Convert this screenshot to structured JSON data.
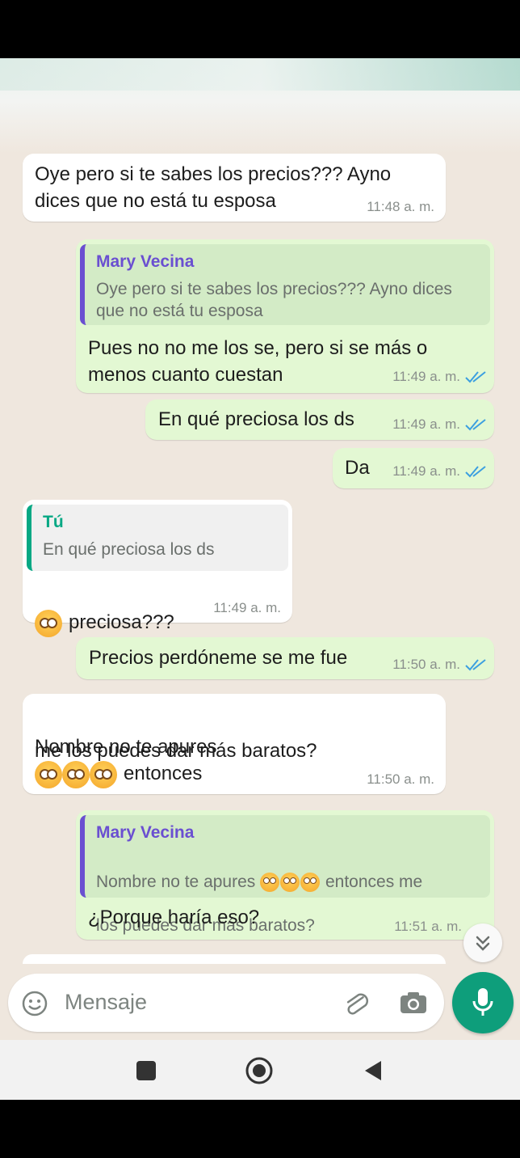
{
  "messages": {
    "m1": {
      "text": "Oye pero si te sabes los precios??? Ayno\ndices que no está tu esposa",
      "time": "11:48 a. m."
    },
    "m2": {
      "quote_name": "Mary Vecina",
      "quote_text": "Oye pero si te sabes los precios??? Ayno dices\nque no está tu esposa",
      "text": "Pues no no me los se, pero si se más o\nmenos cuanto cuestan",
      "time": "11:49 a. m."
    },
    "m3": {
      "text": "En qué preciosa los ds",
      "time": "11:49 a. m."
    },
    "m4": {
      "text": "Da",
      "time": "11:49 a. m."
    },
    "m5": {
      "quote_name": "Tú",
      "quote_text": "En qué preciosa los ds",
      "text": "preciosa???",
      "time": "11:49 a. m."
    },
    "m6": {
      "text": "Precios perdóneme se me fue",
      "time": "11:50 a. m."
    },
    "m7": {
      "text_a": "Nombre no te apures",
      "text_b": "entonces",
      "text_c": "me los puedes dar más baratos?",
      "time": "11:50 a. m."
    },
    "m8": {
      "quote_name": "Mary Vecina",
      "quote_a": "Nombre no te apures",
      "quote_b": "entonces me",
      "quote_c": "los puedes dar más baratos?",
      "text": "¿Porque haría eso?",
      "time": "11:51 a. m."
    }
  },
  "composer": {
    "placeholder": "Mensaje"
  },
  "icons": {
    "emoji": "flushed-face",
    "composer_emoji": "smiley-icon",
    "attach": "paperclip-icon",
    "camera": "camera-icon",
    "mic": "microphone-icon",
    "scroll": "chevrons-down-icon",
    "nav": [
      "square-recents-icon",
      "circle-home-icon",
      "triangle-back-icon"
    ]
  },
  "colors": {
    "outgoing_bubble": "#e3f8d3",
    "incoming_bubble": "#ffffff",
    "read_ticks": "#3c9fe0",
    "mic_button": "#0e9e7b",
    "quote_author_other": "#6a4fd1",
    "quote_author_me": "#06a884"
  }
}
